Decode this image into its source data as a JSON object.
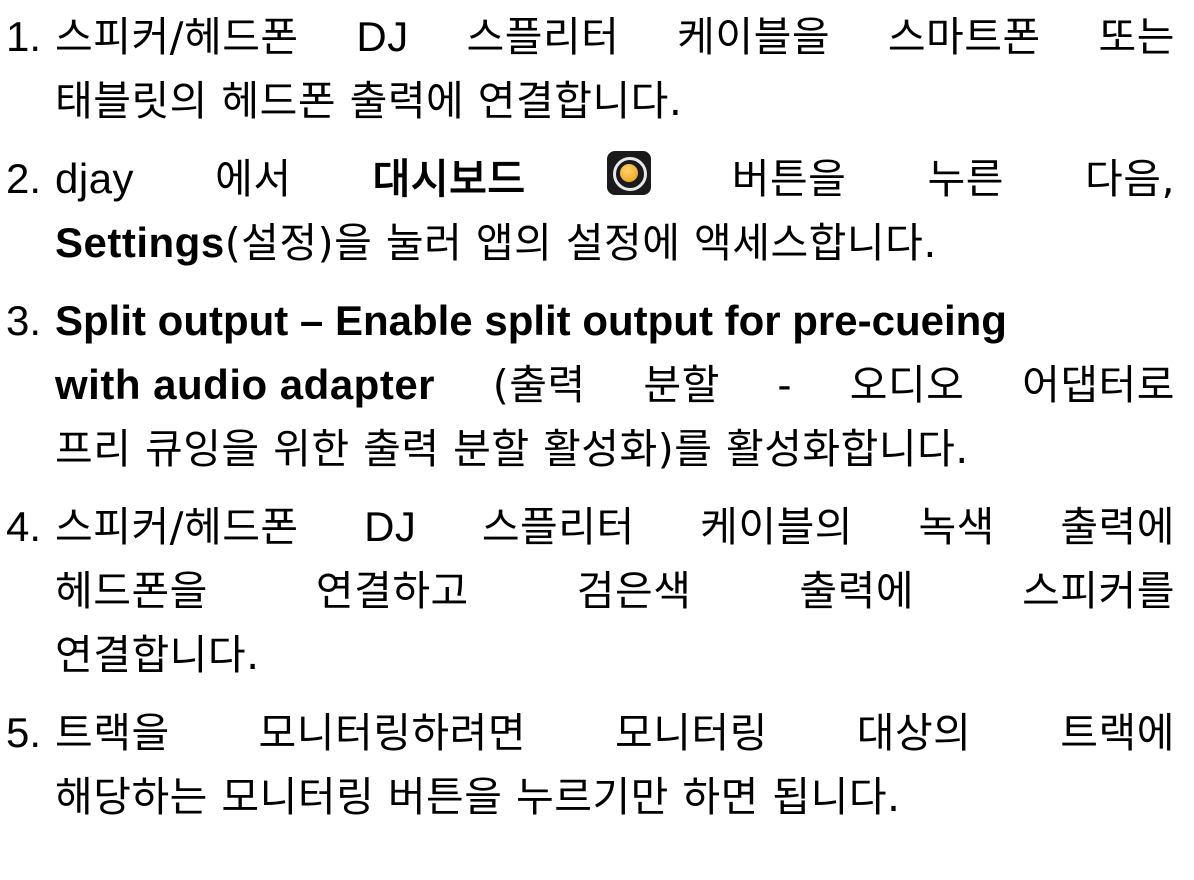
{
  "steps": [
    {
      "num": "1.",
      "l1": {
        "a": "스피커/헤드폰",
        "b": "DJ",
        "c": "스플리터",
        "d": "케이블을",
        "e": "스마트폰",
        "f": "또는"
      },
      "l2": "태블릿의 헤드폰 출력에 연결합니다."
    },
    {
      "num": "2.",
      "l1": {
        "a": "djay",
        "b": "에서",
        "c": "대시보드",
        "d": "버튼을",
        "e": "누른",
        "f": "다음,"
      },
      "icon": "dashboard-icon",
      "l2": {
        "bold": "Settings",
        "rest": "(설정)을 눌러 앱의 설정에 액세스합니다."
      }
    },
    {
      "num": "3.",
      "l1": "Split output – Enable split output for pre-cueing",
      "l2": {
        "bold": "with audio adapter",
        "a": "(출력",
        "b": "분할",
        "c": "-",
        "d": "오디오",
        "e": "어댑터로"
      },
      "l3": "프리 큐잉을 위한 출력 분할 활성화)를 활성화합니다."
    },
    {
      "num": "4.",
      "l1": {
        "a": "스피커/헤드폰",
        "b": "DJ",
        "c": "스플리터",
        "d": "케이블의",
        "e": "녹색",
        "f": "출력에"
      },
      "l2": {
        "a": "헤드폰을",
        "b": "연결하고",
        "c": "검은색",
        "d": "출력에",
        "e": "스피커를"
      },
      "l3": "연결합니다."
    },
    {
      "num": "5.",
      "l1": {
        "a": "트랙을",
        "b": "모니터링하려면",
        "c": "모니터링",
        "d": "대상의",
        "e": "트랙에"
      },
      "l2": "해당하는 모니터링 버튼을 누르기만 하면 됩니다."
    }
  ],
  "colors": {
    "text": "#000000",
    "background": "#ffffff",
    "icon_bg": "#1a1a1a",
    "icon_dot": "#e89a12"
  }
}
